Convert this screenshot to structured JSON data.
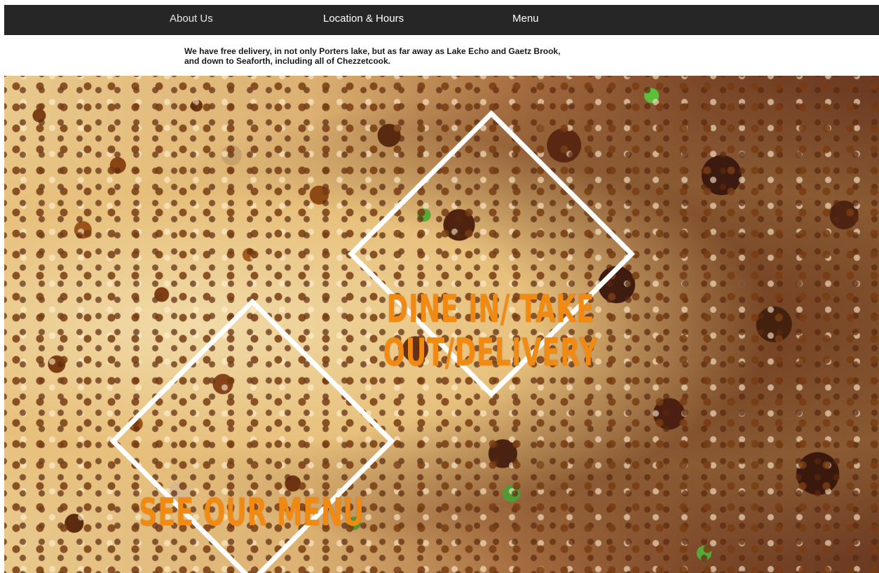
{
  "nav": {
    "about": "About Us",
    "location": "Location & Hours",
    "menu": "Menu"
  },
  "intro": {
    "text": "We have free delivery, in not only Porters lake, but as far away as Lake Echo and Gaetz Brook, and down to Seaforth, including all of Chezzetcook."
  },
  "hero": {
    "dine_cta_line1": "DINE IN/ TAKE",
    "dine_cta_line2": "OUT/DELIVERY",
    "menu_cta": "SEE OUR MENU"
  },
  "colors": {
    "navbar": "#262626",
    "cta_text": "#f28a12",
    "diamond_border": "#ffffff"
  }
}
